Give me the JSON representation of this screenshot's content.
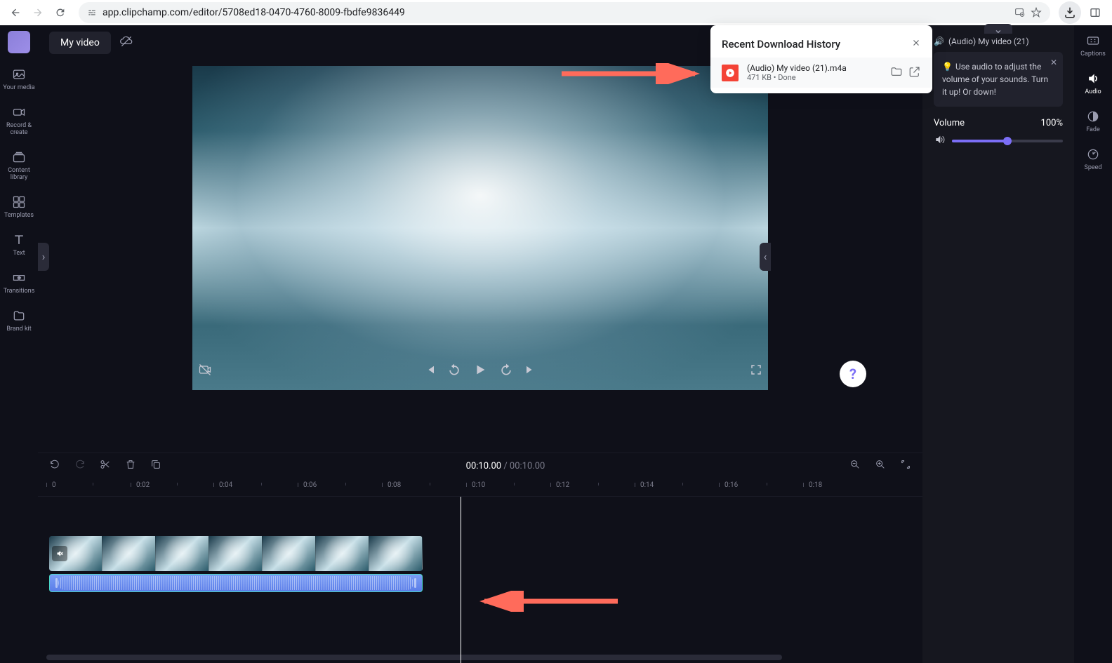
{
  "browser": {
    "url": "app.clipchamp.com/editor/5708ed18-0470-4760-8009-fbdfe9836449"
  },
  "download_popover": {
    "title": "Recent Download History",
    "file_name": "(Audio) My video (21).m4a",
    "file_size": "471 KB",
    "status": "Done"
  },
  "project": {
    "name": "My video"
  },
  "left_nav": {
    "media": "Your media",
    "record": "Record & create",
    "library": "Content library",
    "templates": "Templates",
    "text": "Text",
    "transitions": "Transitions",
    "brand": "Brand kit"
  },
  "right_nav": {
    "captions": "Captions",
    "audio": "Audio",
    "fade": "Fade",
    "speed": "Speed"
  },
  "audio_panel": {
    "clip_label": "(Audio) My video (21)",
    "tip": "Use audio to adjust the volume of your sounds. Turn it up! Or down!",
    "volume_label": "Volume",
    "volume_value": "100%"
  },
  "timeline": {
    "current": "00:10.00",
    "total": "00:10.00",
    "ticks": [
      "0",
      "0:02",
      "0:04",
      "0:06",
      "0:08",
      "0:10",
      "0:12",
      "0:14",
      "0:16",
      "0:18"
    ]
  },
  "help": "?"
}
